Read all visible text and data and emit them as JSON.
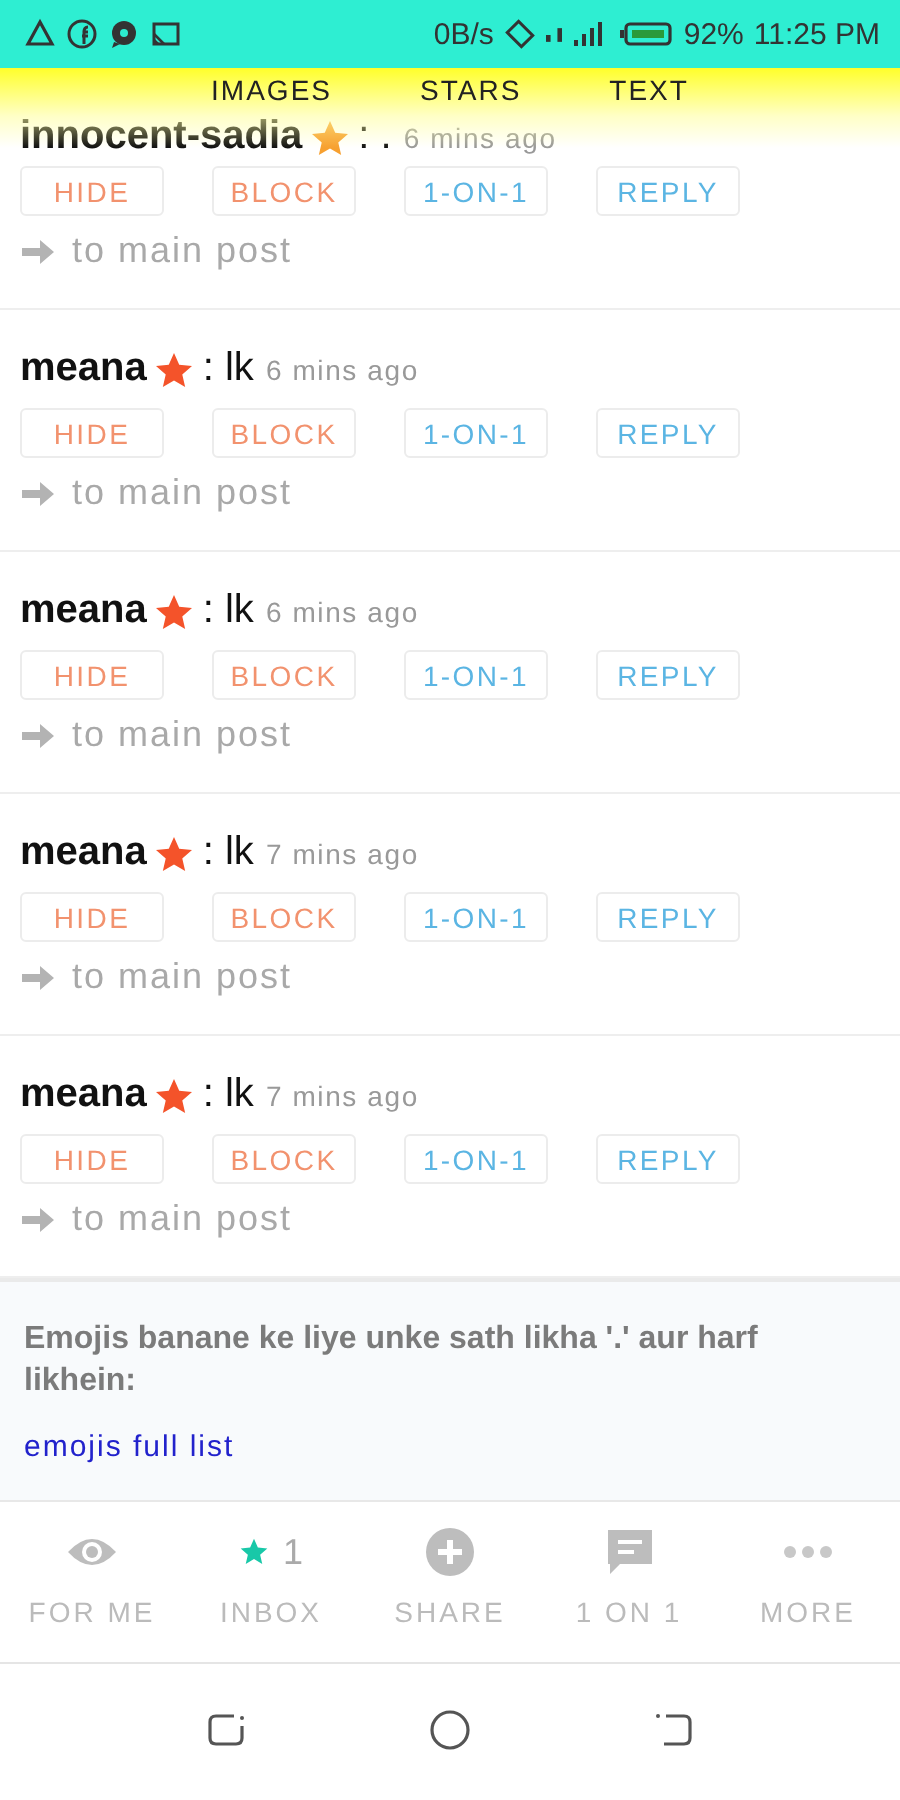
{
  "status_bar": {
    "speed": "0B/s",
    "battery": "92%",
    "time": "11:25 PM"
  },
  "header_tabs": [
    {
      "label": "IMAGES"
    },
    {
      "label": "STARS"
    },
    {
      "label": "TEXT"
    }
  ],
  "posts": [
    {
      "author": "innocent-sadia",
      "color": "#f7a030",
      "text": ": .",
      "time": "6 mins ago",
      "actions": [
        "HIDE",
        "BLOCK",
        "1-ON-1",
        "REPLY"
      ],
      "link": "to main post"
    },
    {
      "author": "meana",
      "color": "#f4532a",
      "text": ": lk",
      "time": "6 mins ago",
      "actions": [
        "HIDE",
        "BLOCK",
        "1-ON-1",
        "REPLY"
      ],
      "link": "to main post"
    },
    {
      "author": "meana",
      "color": "#f4532a",
      "text": ": lk",
      "time": "6 mins ago",
      "actions": [
        "HIDE",
        "BLOCK",
        "1-ON-1",
        "REPLY"
      ],
      "link": "to main post"
    },
    {
      "author": "meana",
      "color": "#f4532a",
      "text": ": lk",
      "time": "7 mins ago",
      "actions": [
        "HIDE",
        "BLOCK",
        "1-ON-1",
        "REPLY"
      ],
      "link": "to main post"
    },
    {
      "author": "meana",
      "color": "#f4532a",
      "text": ": lk",
      "time": "7 mins ago",
      "actions": [
        "HIDE",
        "BLOCK",
        "1-ON-1",
        "REPLY"
      ],
      "link": "to main post"
    }
  ],
  "notice": {
    "text": "Emojis banane ke liye unke sath likha '.' aur harf likhein:",
    "link": "emojis full list"
  },
  "bottom_nav": [
    {
      "label": "FOR ME"
    },
    {
      "label": "INBOX",
      "count": "1"
    },
    {
      "label": "SHARE"
    },
    {
      "label": "1 ON 1"
    },
    {
      "label": "MORE"
    }
  ]
}
